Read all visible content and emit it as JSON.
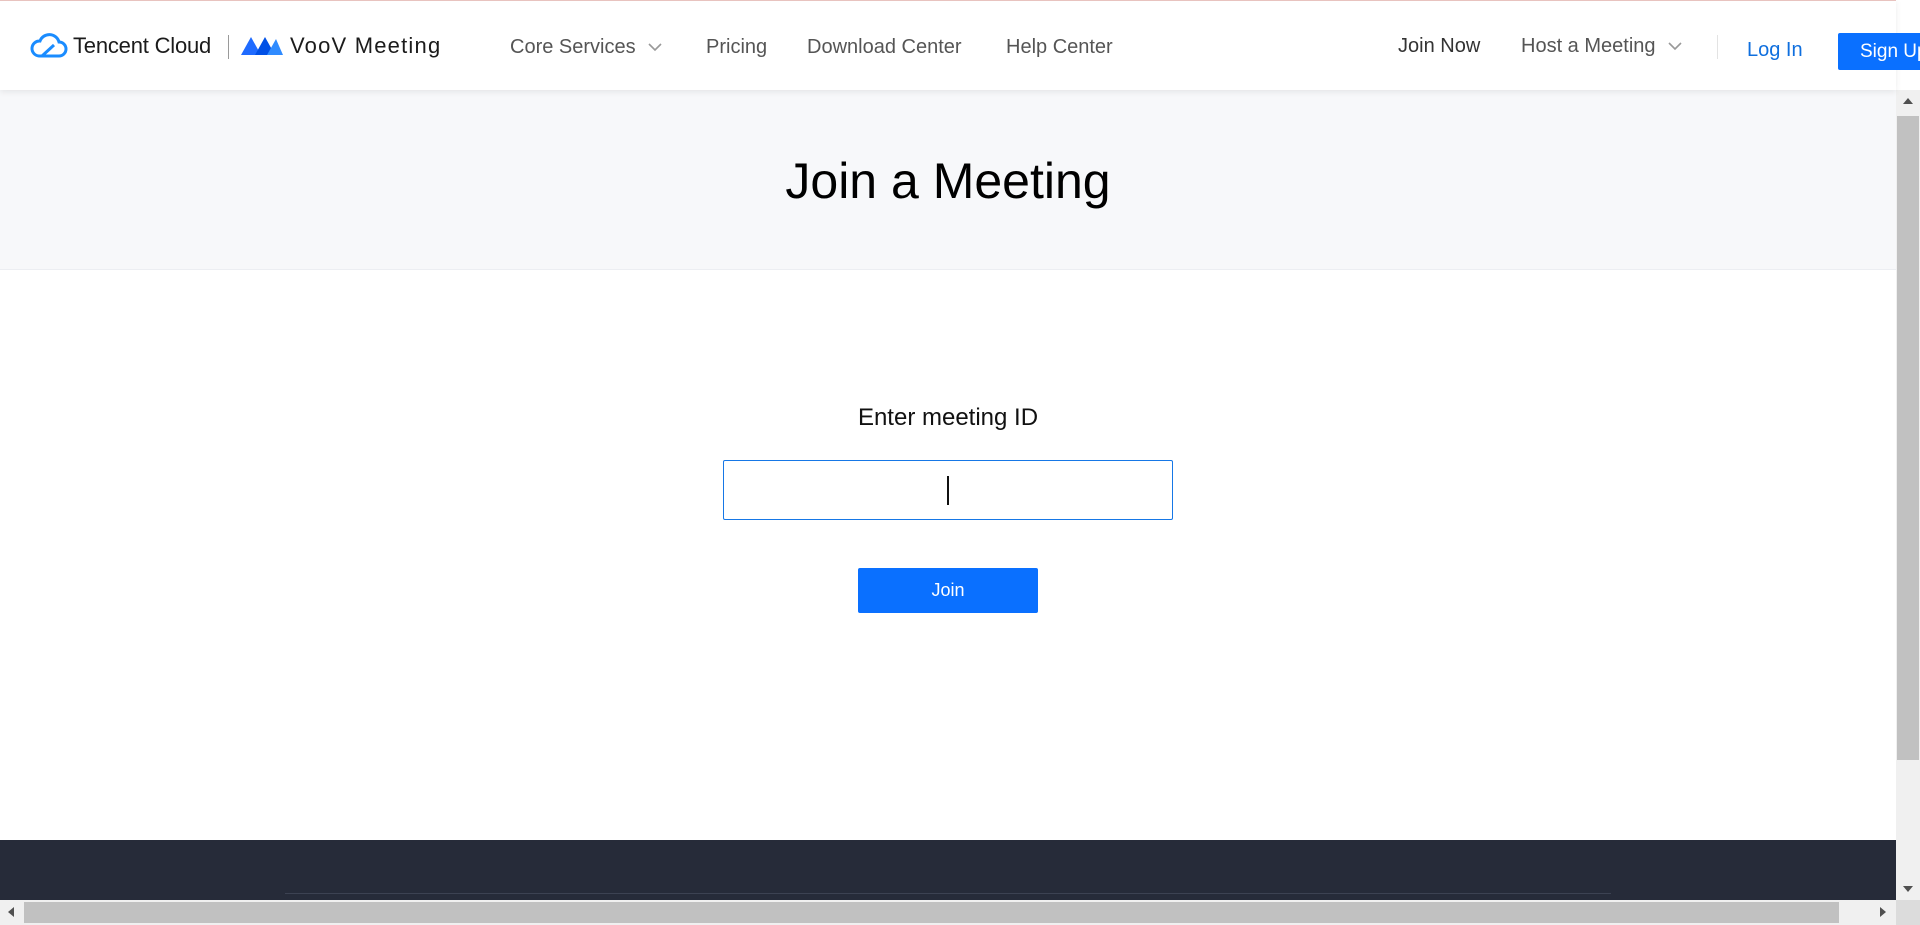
{
  "header": {
    "brand_tencent": "Tencent Cloud",
    "brand_voov": "VooV Meeting",
    "nav": {
      "core_services": "Core Services",
      "pricing": "Pricing",
      "download_center": "Download Center",
      "help_center": "Help Center"
    },
    "right": {
      "join_now": "Join Now",
      "host_meeting": "Host a Meeting",
      "log_in": "Log In",
      "sign_up": "Sign Up"
    }
  },
  "hero": {
    "title": "Join a Meeting"
  },
  "form": {
    "label": "Enter meeting ID",
    "meeting_id_value": "",
    "join_label": "Join"
  },
  "colors": {
    "accent": "#0a70ff",
    "link": "#0f6fde",
    "hero_bg": "#f7f8fa",
    "footer_bg": "#262b39"
  },
  "icons": [
    "tencent-cloud-logo-icon",
    "voov-logo-icon",
    "chevron-down-icon"
  ]
}
